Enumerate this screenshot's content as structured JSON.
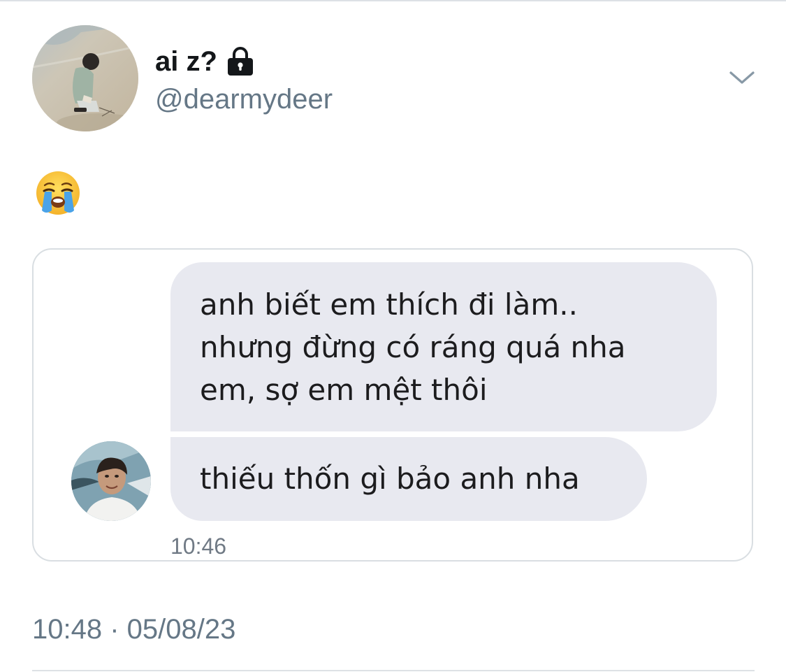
{
  "tweet": {
    "author": {
      "display_name": "ai z?",
      "handle": "@dearmydeer",
      "protected_icon": "lock-icon",
      "avatar": "profile-avatar"
    },
    "menu_icon": "chevron-down-icon",
    "text_emoji": "loudly-crying-face-emoji",
    "timestamp": "10:48 · 05/08/23"
  },
  "embedded_chat": {
    "messages": [
      {
        "lines": [
          "anh biết em thích đi làm..",
          "nhưng đừng có ráng quá nha",
          "em, sợ em mệt thôi"
        ]
      },
      {
        "lines": [
          "thiếu thốn gì bảo anh nha"
        ]
      }
    ],
    "time": "10:46",
    "sender_avatar": "sender-avatar"
  },
  "colors": {
    "name_text": "#14171a",
    "secondary_text": "#657786",
    "bubble_bg": "#e8e9f0",
    "border": "#d9dee2"
  }
}
